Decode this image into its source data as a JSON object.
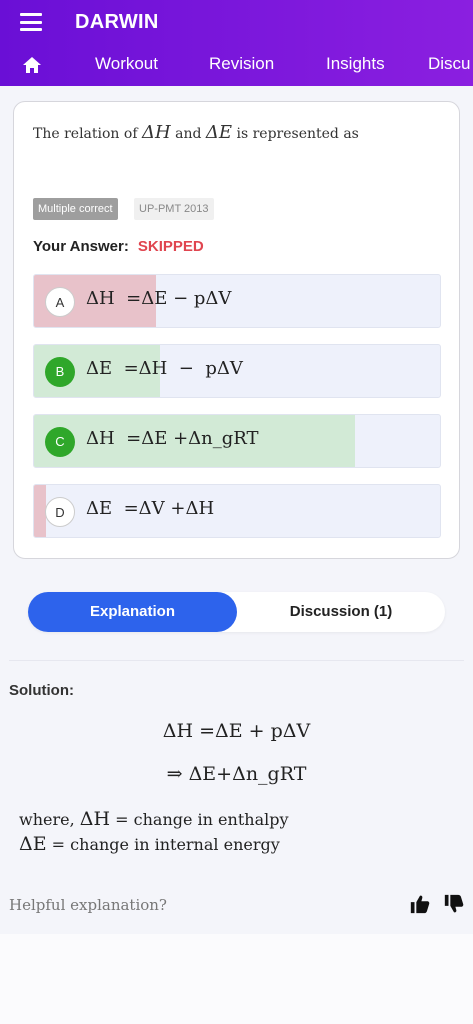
{
  "app": {
    "title": "DARWIN"
  },
  "nav": {
    "home_icon": "home-icon",
    "tabs": [
      "Workout",
      "Revision",
      "Insights",
      "Discu"
    ]
  },
  "question": {
    "prefix": "The relation of ",
    "sym1": "ΔH",
    "mid": " and ",
    "sym2": "ΔE",
    "suffix": " is represented as",
    "tags": {
      "type": "Multiple correct",
      "exam": "UP-PMT 2013"
    },
    "your_answer_label": "Your Answer:",
    "your_answer_value": "SKIPPED"
  },
  "options": [
    {
      "letter": "A",
      "text": "ΔH  =ΔE − pΔV",
      "state": "incorrect",
      "fill_fraction": 0.3
    },
    {
      "letter": "B",
      "text": "ΔE  =ΔH  −  pΔV",
      "state": "correct",
      "fill_fraction": 0.31
    },
    {
      "letter": "C",
      "text": "ΔH  =ΔE +Δn_gRT",
      "state": "correct",
      "fill_fraction": 0.79
    },
    {
      "letter": "D",
      "text": "ΔE  =ΔV +ΔH",
      "state": "incorrect",
      "fill_fraction": 0.03
    }
  ],
  "tabs": {
    "explanation": "Explanation",
    "discussion": "Discussion (1)"
  },
  "solution": {
    "label": "Solution:",
    "eq1": "ΔH =ΔE + pΔV",
    "eq2": "⇒ ΔE+Δn_gRT",
    "note1_prefix": "where, ",
    "note1_sym": "ΔH",
    "note1_suffix": " = change in enthalpy",
    "note2_sym": "ΔE",
    "note2_suffix": " = change in internal energy"
  },
  "feedback": {
    "label": "Helpful explanation?",
    "up_icon": "thumbs-up-icon",
    "down_icon": "thumbs-down-icon"
  },
  "colors": {
    "header_start": "#6a0fd6",
    "header_end": "#8b1fe0",
    "incorrect_fill": "#e8c2ca",
    "correct_fill": "#d2ead6",
    "badge_green": "#2fa72a",
    "accent_blue": "#2d63ec",
    "skipped_red": "#e0454f"
  }
}
